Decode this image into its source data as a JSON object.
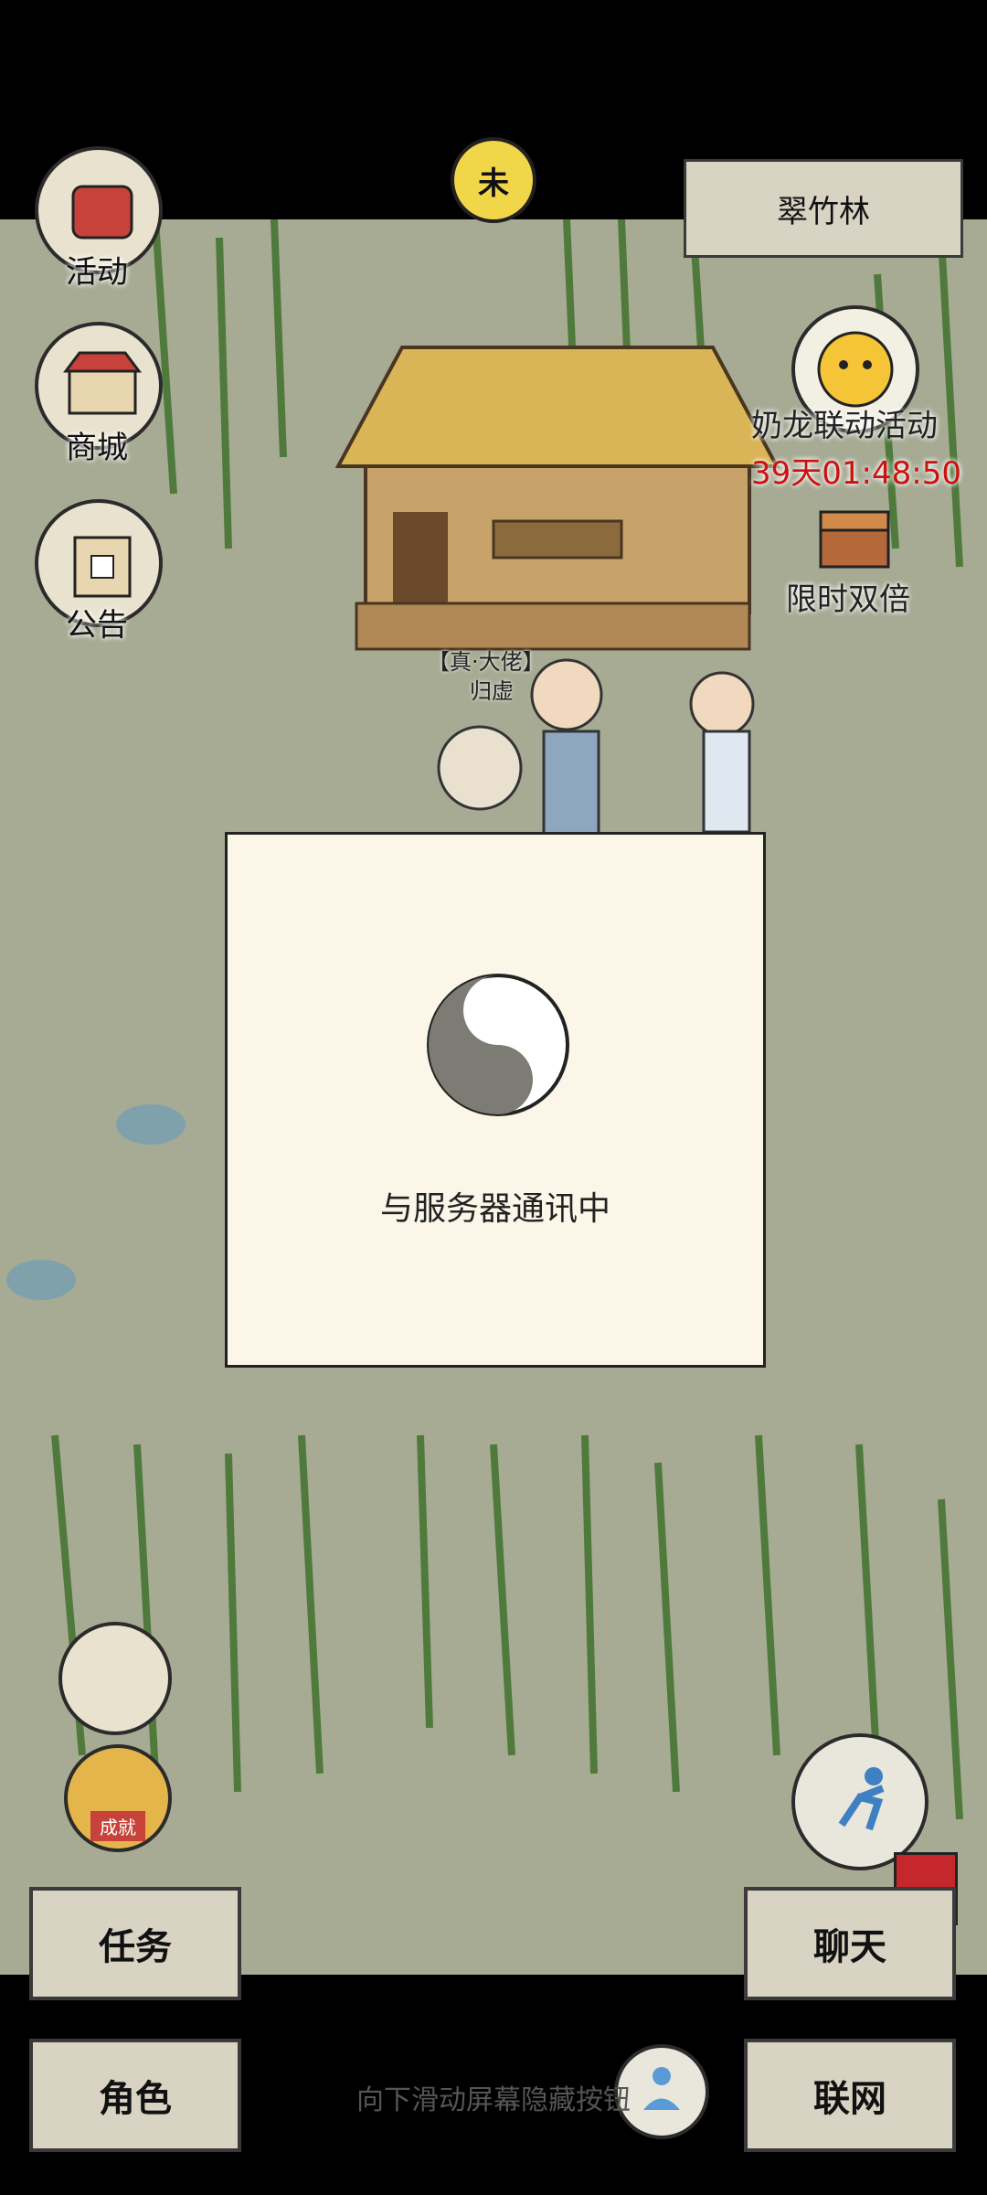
{
  "location": "翠竹林",
  "time_badge": "未",
  "left_menu": {
    "activity": "活动",
    "shop": "商城",
    "notice": "公告"
  },
  "event": {
    "name": "奶龙联动活动",
    "timer": "39天01:48:50",
    "double": "限时双倍"
  },
  "player": {
    "title": "【真·大佬】",
    "name": "归虚"
  },
  "modal": {
    "message": "与服务器通讯中"
  },
  "bottom": {
    "task": "任务",
    "chat": "聊天",
    "character": "角色",
    "network": "联网",
    "achievement_badge": "成就"
  },
  "hint": "向下滑动屏幕隐藏按钮",
  "colors": {
    "scene_bg": "#a7ab94",
    "panel_bg": "#d8d3c2",
    "modal_bg": "#fbf6e7",
    "timer": "#cc1111"
  }
}
